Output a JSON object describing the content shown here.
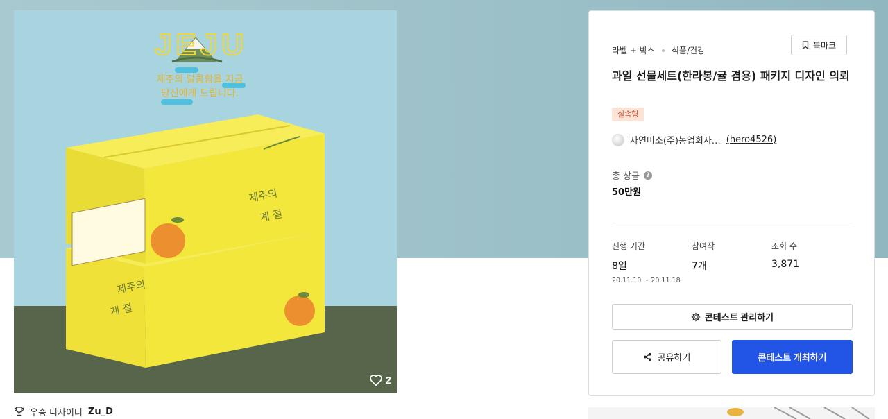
{
  "product": {
    "likes": "2",
    "image_text": {
      "logo": "JEJU",
      "headline_line1": "제주의 달콤함을 지금",
      "headline_line2": "당신에게 드립니다.",
      "box_script1": "제주의",
      "box_script2": "계 절"
    }
  },
  "winner": {
    "label": "우승 디자이너",
    "name": "Zu_D"
  },
  "contest": {
    "category": "라벨 + 박스",
    "subcategory": "식품/건강",
    "bookmark_label": "북마크",
    "title": "과일 선물세트(한라봉/귤 겸용) 패키지 디자인 의뢰",
    "badge": "실속형",
    "host_name": "자연미소(주)농업회사…",
    "host_id": "(hero4526)",
    "prize_label": "총 상금",
    "prize_value": "50만원",
    "stats": {
      "period_label": "진행 기간",
      "period_value": "8일",
      "period_dates": "20.11.10 ~ 20.11.18",
      "entries_label": "참여작",
      "entries_value": "7개",
      "views_label": "조회 수",
      "views_value": "3,871"
    },
    "manage_label": "콘테스트 관리하기",
    "share_label": "공유하기",
    "host_contest_label": "콘테스트 개최하기"
  },
  "colors": {
    "primary": "#2255e6",
    "badge_bg": "#fbe3d6",
    "badge_text": "#c9543a",
    "box_yellow": "#f2e73a",
    "sky": "#a7d4df",
    "floor": "#57664a"
  },
  "icons": [
    "heart-icon",
    "trophy-icon",
    "bookmark-icon",
    "help-icon",
    "gear-icon",
    "share-icon"
  ]
}
